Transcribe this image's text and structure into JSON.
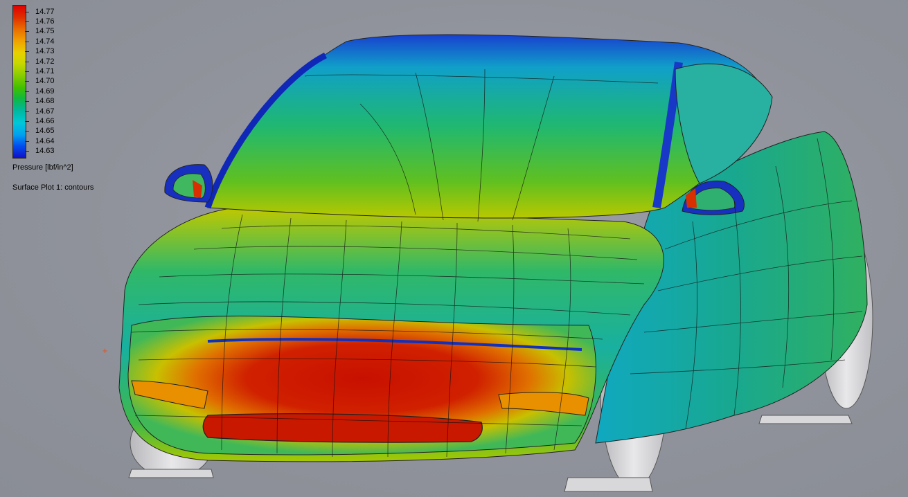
{
  "legend": {
    "ticks": [
      "14.77",
      "14.76",
      "14.75",
      "14.74",
      "14.73",
      "14.72",
      "14.71",
      "14.70",
      "14.69",
      "14.68",
      "14.67",
      "14.66",
      "14.65",
      "14.64",
      "14.63"
    ],
    "units": "Pressure [lbf/in^2]",
    "plot_name": "Surface Plot 1: contours",
    "colors": {
      "max": "#e00000",
      "high": "#f0a000",
      "mid": "#40c000",
      "low": "#00c8d8",
      "min": "#1010c8"
    }
  },
  "scene": {
    "background": "#8e9199",
    "object": "car-surface-pressure-contour",
    "triad_glyph": "+"
  }
}
